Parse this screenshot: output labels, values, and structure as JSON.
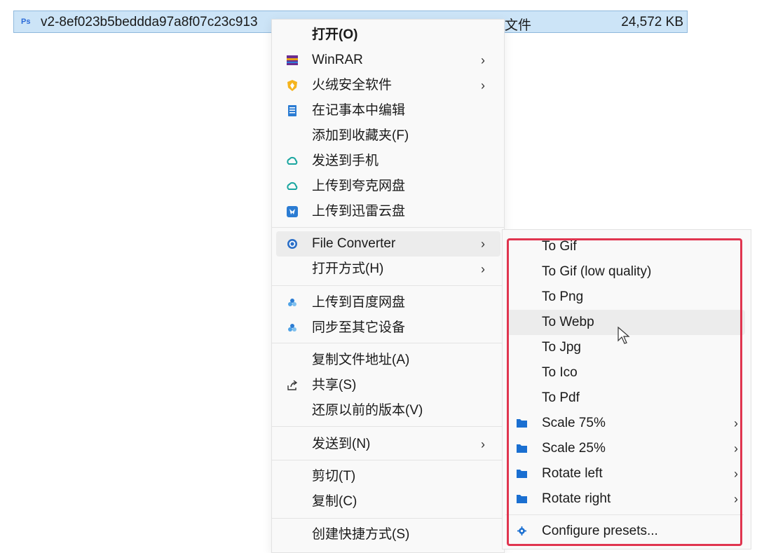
{
  "file": {
    "name": "v2-8ef023b5beddda97a8f07c23c913",
    "type": "文件",
    "size": "24,572 KB",
    "icon": "ps-file-icon",
    "icon_text": "Ps"
  },
  "menu": {
    "items": [
      {
        "label": "打开(O)",
        "icon": null
      },
      {
        "label": "WinRAR",
        "icon": "winrar-icon",
        "submenu": true
      },
      {
        "label": "火绒安全软件",
        "icon": "huorong-icon",
        "submenu": true
      },
      {
        "label": "在记事本中编辑",
        "icon": "notepad-icon"
      },
      {
        "label": "添加到收藏夹(F)",
        "icon": null
      },
      {
        "label": "发送到手机",
        "icon": "quark-cloud-icon"
      },
      {
        "label": "上传到夸克网盘",
        "icon": "quark-cloud-icon"
      },
      {
        "label": "上传到迅雷云盘",
        "icon": "xunlei-icon"
      },
      {
        "label": "File Converter",
        "icon": "file-converter-icon",
        "submenu": true
      },
      {
        "label": "打开方式(H)",
        "icon": null,
        "submenu": true
      },
      {
        "label": "上传到百度网盘",
        "icon": "baidu-cloud-icon"
      },
      {
        "label": "同步至其它设备",
        "icon": "baidu-cloud-icon"
      },
      {
        "label": "复制文件地址(A)",
        "icon": null
      },
      {
        "label": "共享(S)",
        "icon": "share-icon"
      },
      {
        "label": "还原以前的版本(V)",
        "icon": null
      },
      {
        "label": "发送到(N)",
        "icon": null,
        "submenu": true
      },
      {
        "label": "剪切(T)",
        "icon": null
      },
      {
        "label": "复制(C)",
        "icon": null
      },
      {
        "label": "创建快捷方式(S)",
        "icon": null
      }
    ]
  },
  "submenu": {
    "items": [
      {
        "label": "To Gif"
      },
      {
        "label": "To Gif (low quality)"
      },
      {
        "label": "To Png"
      },
      {
        "label": "To Webp"
      },
      {
        "label": "To Jpg"
      },
      {
        "label": "To Ico"
      },
      {
        "label": "To Pdf"
      },
      {
        "label": "Scale 75%",
        "icon": "folder-icon",
        "submenu": true
      },
      {
        "label": "Scale 25%",
        "icon": "folder-icon",
        "submenu": true
      },
      {
        "label": "Rotate left",
        "icon": "folder-icon",
        "submenu": true
      },
      {
        "label": "Rotate right",
        "icon": "folder-icon",
        "submenu": true
      },
      {
        "label": "Configure presets...",
        "icon": "gear-icon"
      }
    ]
  },
  "colors": {
    "selection": "#cce4f7",
    "highlight_border": "#e0354f",
    "folder": "#1a6fd1"
  },
  "arrow_glyph": "›"
}
